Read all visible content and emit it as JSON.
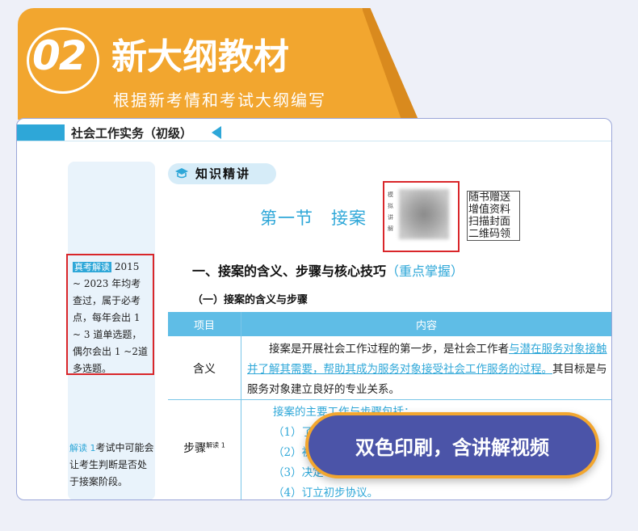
{
  "banner": {
    "number": "02",
    "title": "新大纲教材",
    "subtitle": "根据新考情和考试大纲编写"
  },
  "book": {
    "header": "社会工作实务（初级）",
    "sidebar": {
      "note1_tag": "真考解读",
      "note1_text": "2015 ~ 2023 年均考查过，属于必考点，每年会出 1 ~ 3 道单选题，偶尔会出 1 ~2道多选题。",
      "note2_tag": "解读 1",
      "note2_text": "考试中可能会让考生判断是否处于接案阶段。"
    },
    "knowledge_badge": "知识精讲",
    "section_title": "第一节　接案",
    "qr_side_text": "模拟讲解",
    "qr_caption": [
      "随书赠送",
      "增值资料",
      "扫描封面",
      "二维码领"
    ],
    "heading1": "一、接案的含义、步骤与核心技巧",
    "heading1_emphasis": "（重点掌握）",
    "heading2": "（一）接案的含义与步骤",
    "table": {
      "col1": "项目",
      "col2": "内容",
      "row1_label": "含义",
      "row1_text_a": "接案是开展社会工作过程的第一步，是社会工作者",
      "row1_text_u": "与潜在服务对象接触并了解其需要，帮助其成为服务对象接受社会工作服务的过程。",
      "row1_text_b": "其目标是与服务对象建立良好的专业关系。",
      "row2_label": "步骤",
      "row2_sup": "解读 1",
      "row2_lines": [
        "接案的主要工作与步骤包括：",
        "（1）了",
        "（2）初",
        "（3）决定",
        "（4）订立初步协议。"
      ]
    }
  },
  "callout": "双色印刷，含讲解视频"
}
